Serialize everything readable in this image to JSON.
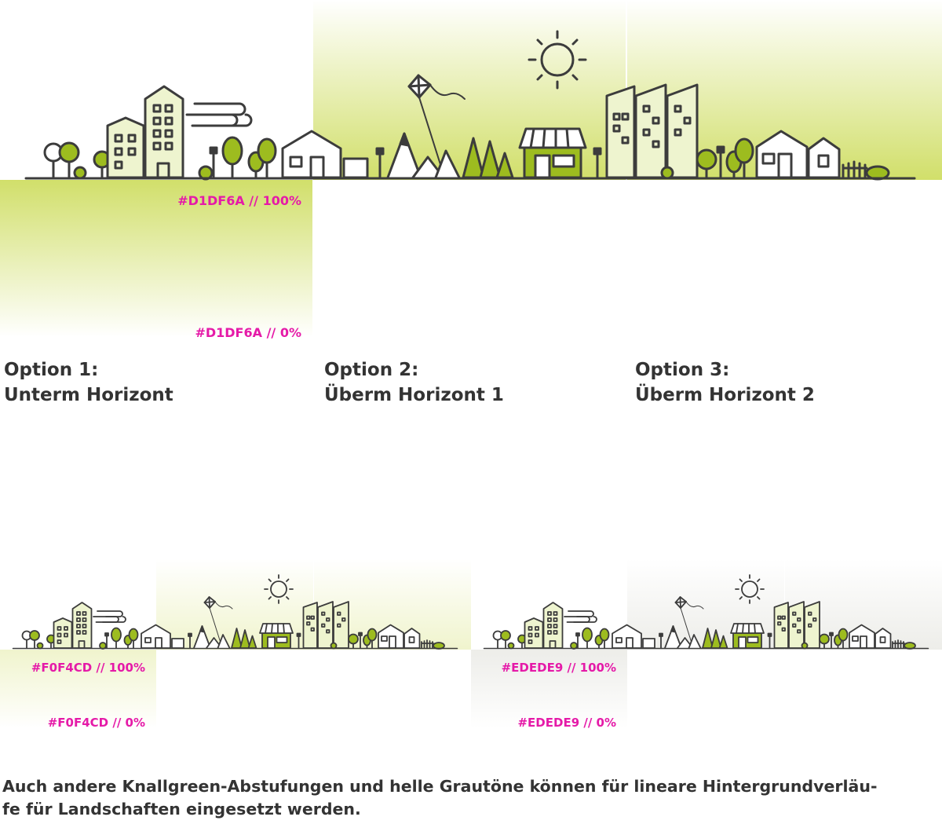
{
  "main_example": {
    "gradient_color": "#D1DF6A",
    "label_top": "#D1DF6A // 100%",
    "label_bottom": "#D1DF6A // 0%"
  },
  "options": [
    {
      "line1": "Option 1:",
      "line2": "Unterm Horizont"
    },
    {
      "line1": "Option 2:",
      "line2": "Überm Horizont 1"
    },
    {
      "line1": "Option 3:",
      "line2": "Überm Horizont 2"
    }
  ],
  "small_examples": [
    {
      "gradient_color": "#F0F4CD",
      "label_top": "#F0F4CD // 100%",
      "label_bottom": "#F0F4CD // 0%"
    },
    {
      "gradient_color": "#EDEDE9",
      "label_top": "#EDEDE9 // 100%",
      "label_bottom": "#EDEDE9 // 0%"
    }
  ],
  "caption": {
    "line1": "Auch andere Knallgreen-Abstufungen und helle Grautöne können für lineare Hintergrundverläu-",
    "line2": "fe für Landschaften eingesetzt werden."
  },
  "colors": {
    "accent_green": "#9dbc1f",
    "light_fill": "#eef4cf",
    "line": "#3c3c3c",
    "label_magenta": "#e51aa8"
  }
}
